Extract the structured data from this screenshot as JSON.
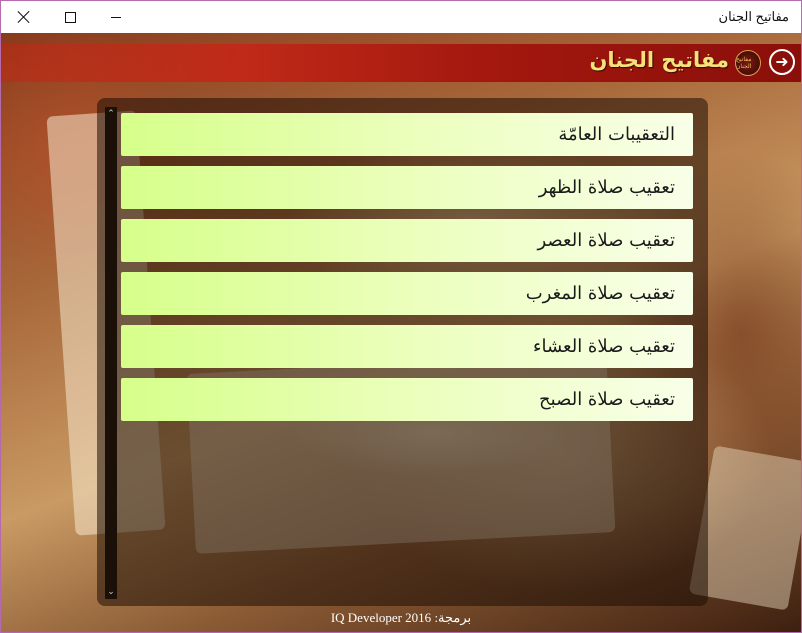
{
  "window": {
    "title": "مفاتيح الجنان",
    "controls": {
      "close": "close",
      "maximize": "maximize",
      "minimize": "minimize"
    }
  },
  "header": {
    "title": "مفاتيح الجنان",
    "back_icon": "arrow-right-circle-icon",
    "logo_icon": "calligraphy-logo-icon",
    "logo_text": "مفاتيح الجنان"
  },
  "list": {
    "items": [
      {
        "label": "التعقيبات العامّة"
      },
      {
        "label": "تعقيب صلاة الظهر"
      },
      {
        "label": "تعقيب صلاة العصر"
      },
      {
        "label": "تعقيب صلاة المغرب"
      },
      {
        "label": "تعقيب صلاة العشاء"
      },
      {
        "label": "تعقيب صلاة الصبح"
      }
    ]
  },
  "scrollbar": {
    "up_icon": "chevron-up-icon",
    "down_icon": "chevron-down-icon"
  },
  "footer": {
    "credit": "برمجة: IQ Developer 2016"
  },
  "colors": {
    "header_red": "#a4180f",
    "title_gold": "#f6e27a",
    "item_green_light": "#f8ffe8",
    "item_green_bright": "#d6ff8a"
  }
}
